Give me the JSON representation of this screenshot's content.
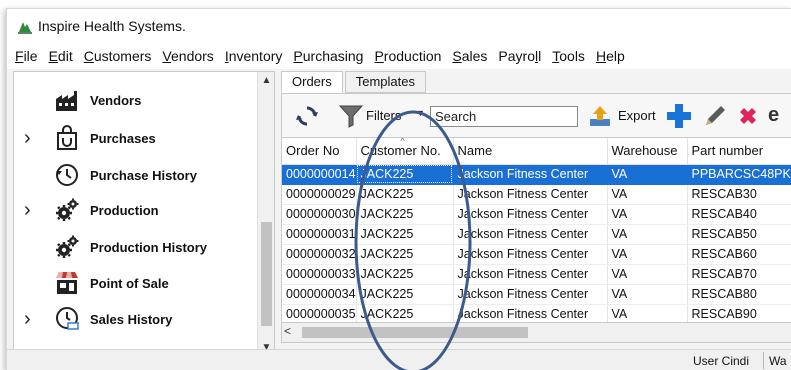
{
  "app": {
    "title": "Inspire Health Systems."
  },
  "menu": [
    {
      "label": "File",
      "key": "F",
      "rest": "ile"
    },
    {
      "label": "Edit",
      "key": "E",
      "rest": "dit"
    },
    {
      "label": "Customers",
      "key": "C",
      "rest": "ustomers"
    },
    {
      "label": "Vendors",
      "key": "V",
      "rest": "endors"
    },
    {
      "label": "Inventory",
      "key": "I",
      "rest": "nventory"
    },
    {
      "label": "Purchasing",
      "key": "P",
      "rest": "urchasing"
    },
    {
      "label": "Production",
      "key": "P",
      "rest": "roduction"
    },
    {
      "label": "Sales",
      "key": "S",
      "rest": "ales"
    },
    {
      "label": "Payroll",
      "pre": "Payro",
      "key": "l",
      "rest": "l"
    },
    {
      "label": "Tools",
      "key": "T",
      "rest": "ools"
    },
    {
      "label": "Help",
      "key": "H",
      "rest": "elp"
    }
  ],
  "sidebar": {
    "items": [
      {
        "label": "Vendors",
        "icon": "factory-icon",
        "expandable": false
      },
      {
        "label": "Purchases",
        "icon": "shopping-bag-icon",
        "expandable": true
      },
      {
        "label": "Purchase History",
        "icon": "clock-history-icon",
        "expandable": false
      },
      {
        "label": "Production",
        "icon": "gears-icon",
        "expandable": true
      },
      {
        "label": "Production History",
        "icon": "gears-icon",
        "expandable": false
      },
      {
        "label": "Point of Sale",
        "icon": "cash-register-icon",
        "expandable": false
      },
      {
        "label": "Sales History",
        "icon": "clock-cart-icon",
        "expandable": true
      }
    ]
  },
  "tabs": [
    {
      "label": "Orders",
      "active": true
    },
    {
      "label": "Templates",
      "active": false
    }
  ],
  "toolbar": {
    "filters_label": "Filters",
    "search_placeholder": "Search",
    "export_label": "Export"
  },
  "grid": {
    "columns": [
      "Order No",
      "Customer No.",
      "Name",
      "Warehouse",
      "Part number"
    ],
    "rows": [
      [
        "0000000014",
        "JACK225",
        "Jackson Fitness Center",
        "VA",
        "PPBARCSC48PK"
      ],
      [
        "0000000029",
        "JACK225",
        "Jackson Fitness Center",
        "VA",
        "RESCAB30"
      ],
      [
        "0000000030",
        "JACK225",
        "Jackson Fitness Center",
        "VA",
        "RESCAB40"
      ],
      [
        "0000000031",
        "JACK225",
        "Jackson Fitness Center",
        "VA",
        "RESCAB50"
      ],
      [
        "0000000032",
        "JACK225",
        "Jackson Fitness Center",
        "VA",
        "RESCAB60"
      ],
      [
        "0000000033",
        "JACK225",
        "Jackson Fitness Center",
        "VA",
        "RESCAB70"
      ],
      [
        "0000000034",
        "JACK225",
        "Jackson Fitness Center",
        "VA",
        "RESCAB80"
      ],
      [
        "0000000035",
        "JACK225",
        "Jackson Fitness Center",
        "VA",
        "RESCAB90"
      ]
    ],
    "selected_row": 0
  },
  "status": {
    "user": "User Cindi",
    "extra": "Wa"
  },
  "colors": {
    "selection": "#1a6fd4",
    "annotation": "#3c5a8a",
    "add_icon": "#1a73d9",
    "delete_icon": "#e0245e"
  }
}
